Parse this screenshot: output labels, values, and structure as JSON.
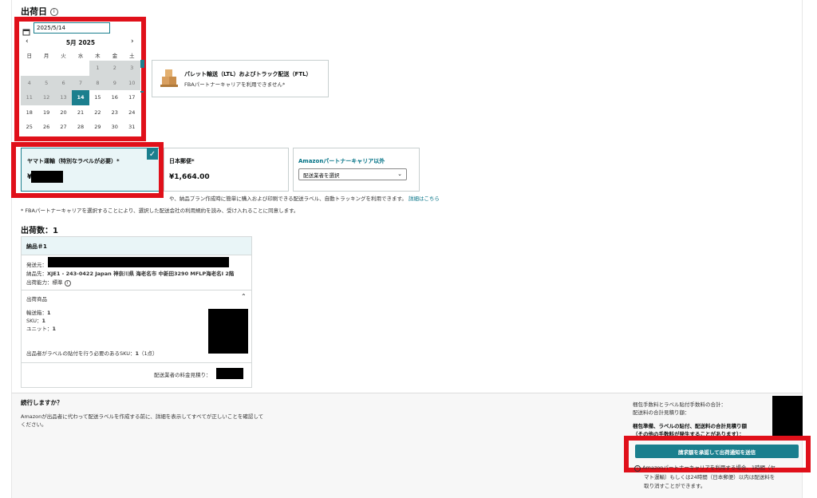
{
  "header": {
    "title": "出荷日"
  },
  "date_input": {
    "value": "2025/5/14"
  },
  "calendar": {
    "month_label": "5月 2025",
    "weekdays": [
      "日",
      "月",
      "火",
      "水",
      "木",
      "金",
      "土"
    ],
    "rows": [
      [
        {
          "d": "",
          "t": "b"
        },
        {
          "d": "",
          "t": "b"
        },
        {
          "d": "",
          "t": "b"
        },
        {
          "d": "",
          "t": "b"
        },
        {
          "d": "1",
          "t": "dis"
        },
        {
          "d": "2",
          "t": "dis"
        },
        {
          "d": "3",
          "t": "dis"
        }
      ],
      [
        {
          "d": "4",
          "t": "dis"
        },
        {
          "d": "5",
          "t": "dis"
        },
        {
          "d": "6",
          "t": "dis"
        },
        {
          "d": "7",
          "t": "dis"
        },
        {
          "d": "8",
          "t": "dis"
        },
        {
          "d": "9",
          "t": "dis"
        },
        {
          "d": "10",
          "t": "dis"
        }
      ],
      [
        {
          "d": "11",
          "t": "dis"
        },
        {
          "d": "12",
          "t": "dis"
        },
        {
          "d": "13",
          "t": "dis"
        },
        {
          "d": "14",
          "t": "sel"
        },
        {
          "d": "15",
          "t": "on"
        },
        {
          "d": "16",
          "t": "on"
        },
        {
          "d": "17",
          "t": "on"
        }
      ],
      [
        {
          "d": "18",
          "t": "on"
        },
        {
          "d": "19",
          "t": "on"
        },
        {
          "d": "20",
          "t": "on"
        },
        {
          "d": "21",
          "t": "on"
        },
        {
          "d": "22",
          "t": "on"
        },
        {
          "d": "23",
          "t": "on"
        },
        {
          "d": "24",
          "t": "on"
        }
      ],
      [
        {
          "d": "25",
          "t": "on"
        },
        {
          "d": "26",
          "t": "on"
        },
        {
          "d": "27",
          "t": "on"
        },
        {
          "d": "28",
          "t": "on"
        },
        {
          "d": "29",
          "t": "on"
        },
        {
          "d": "30",
          "t": "on"
        },
        {
          "d": "31",
          "t": "on"
        }
      ]
    ]
  },
  "shipping_mode": {
    "pallet_title": "パレット輸送（LTL）およびトラック配送（FTL）",
    "pallet_sub": "FBAパートナーキャリアを利用できません*"
  },
  "carriers": {
    "yamato_label": "ヤマト運輸（特別なラベルが必要）*",
    "yamato_price_prefix": "¥",
    "japanpost_label": "日本郵便*",
    "japanpost_price": "¥1,664.00",
    "amazon_other_label": "Amazonパートナーキャリア以外",
    "carrier_select_placeholder": "配送業者を選択"
  },
  "notes": {
    "line1": "や、納品プラン作成時に簡単に購入および印刷できる配送ラベル、自動トラッキングを利用できます。",
    "line1_link": "詳細はこちら",
    "line2": "* FBAパートナーキャリアを選択することにより、選択した配送会社の利用規約を読み、受け入れることに同意します。"
  },
  "shipment": {
    "count_title": "出荷数：1",
    "box_title": "納品＃1",
    "from_label": "発送元：",
    "to_label": "納品先：",
    "to_value": "XJE1 - 243-0422 Japan 神奈川県 海老名市 中新田3290 MFLP海老名Ⅰ 2階",
    "capability_label": "出荷能力：",
    "capability_value": "標準",
    "products_title": "出荷商品",
    "boxes_label": "輸送箱：",
    "boxes_value": "1",
    "sku_label": "SKU：",
    "sku_value": "1",
    "units_label": "ユニット：",
    "units_value": "1",
    "label_sku_text": "出品者がラベルの貼付を行う必要のあるSKU：",
    "label_sku_value": "1",
    "label_sku_suffix": "（1点）",
    "carrier_quote_label": "配送業者の料金見積り："
  },
  "footer": {
    "continue_title": "続行しますか？",
    "continue_desc1": "Amazonが出品者に代わって配送ラベルを作成する前に、詳細を表示してすべてが正しいことを確認して",
    "continue_desc2": "ください。",
    "fee_total_label": "梱包手数料とラベル貼付手数料の合計：",
    "shipping_estimate_label": "配送料の合計見積り額：",
    "grand_total_line1": "梱包準備、ラベルの貼付、配送料の合計見積り額",
    "grand_total_line2": "（その他の手数料が発生することがあります）：",
    "submit_label": "請求額を承認して出荷通知を送信",
    "info_line1": "Amazonパートナーキャリアを利用する場合、1時間（ヤ",
    "info_line2": "マト運輸）もしくは24時間（日本郵便）以内は配送料を",
    "info_line3": "取り消すことができます。"
  },
  "colors": {
    "accent": "#1b7f8e",
    "highlight": "#e0101a",
    "redact": "#000000"
  }
}
